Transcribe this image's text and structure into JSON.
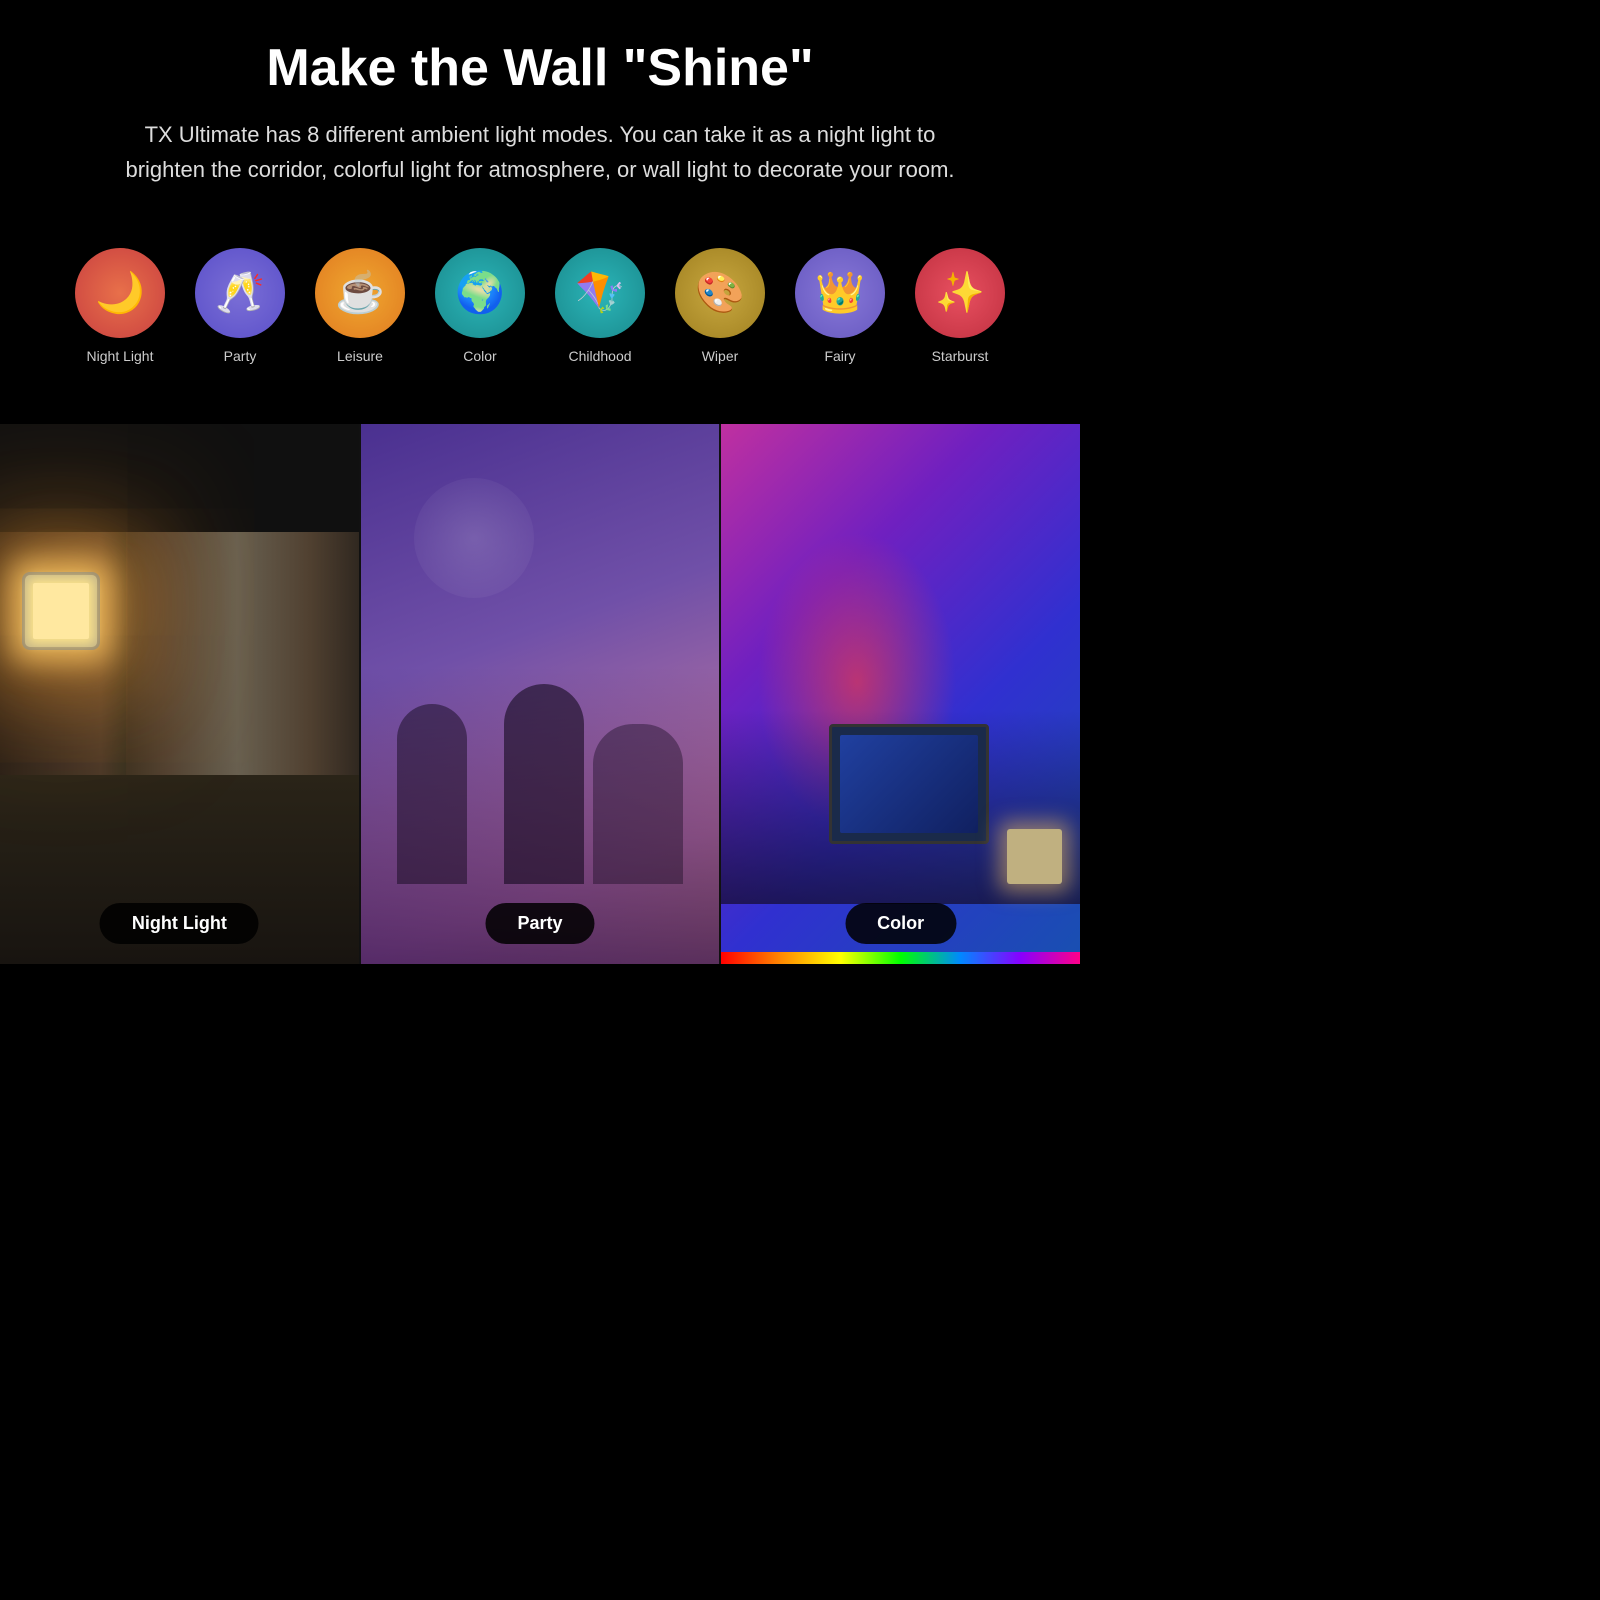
{
  "header": {
    "title": "Make the Wall \"Shine\"",
    "subtitle": "TX Ultimate has 8 different ambient light modes. You can take it as a night light to brighten the corridor, colorful light for atmosphere, or wall light to decorate your room."
  },
  "modes": [
    {
      "id": "night-light",
      "label": "Night Light",
      "emoji": "🌙",
      "colorClass": "night-light"
    },
    {
      "id": "party",
      "label": "Party",
      "emoji": "🥂",
      "colorClass": "party"
    },
    {
      "id": "leisure",
      "label": "Leisure",
      "emoji": "☕",
      "colorClass": "leisure"
    },
    {
      "id": "color",
      "label": "Color",
      "emoji": "🌍",
      "colorClass": "color"
    },
    {
      "id": "childhood",
      "label": "Childhood",
      "emoji": "🪁",
      "colorClass": "childhood"
    },
    {
      "id": "wiper",
      "label": "Wiper",
      "emoji": "🎨",
      "colorClass": "wiper"
    },
    {
      "id": "fairy",
      "label": "Fairy",
      "emoji": "👑",
      "colorClass": "fairy"
    },
    {
      "id": "starburst",
      "label": "Starburst",
      "emoji": "✨",
      "colorClass": "starburst"
    }
  ],
  "photos": [
    {
      "id": "night-light-photo",
      "label": "Night Light",
      "type": "nl"
    },
    {
      "id": "party-photo",
      "label": "Party",
      "type": "pt"
    },
    {
      "id": "color-photo",
      "label": "Color",
      "type": "cl"
    }
  ]
}
